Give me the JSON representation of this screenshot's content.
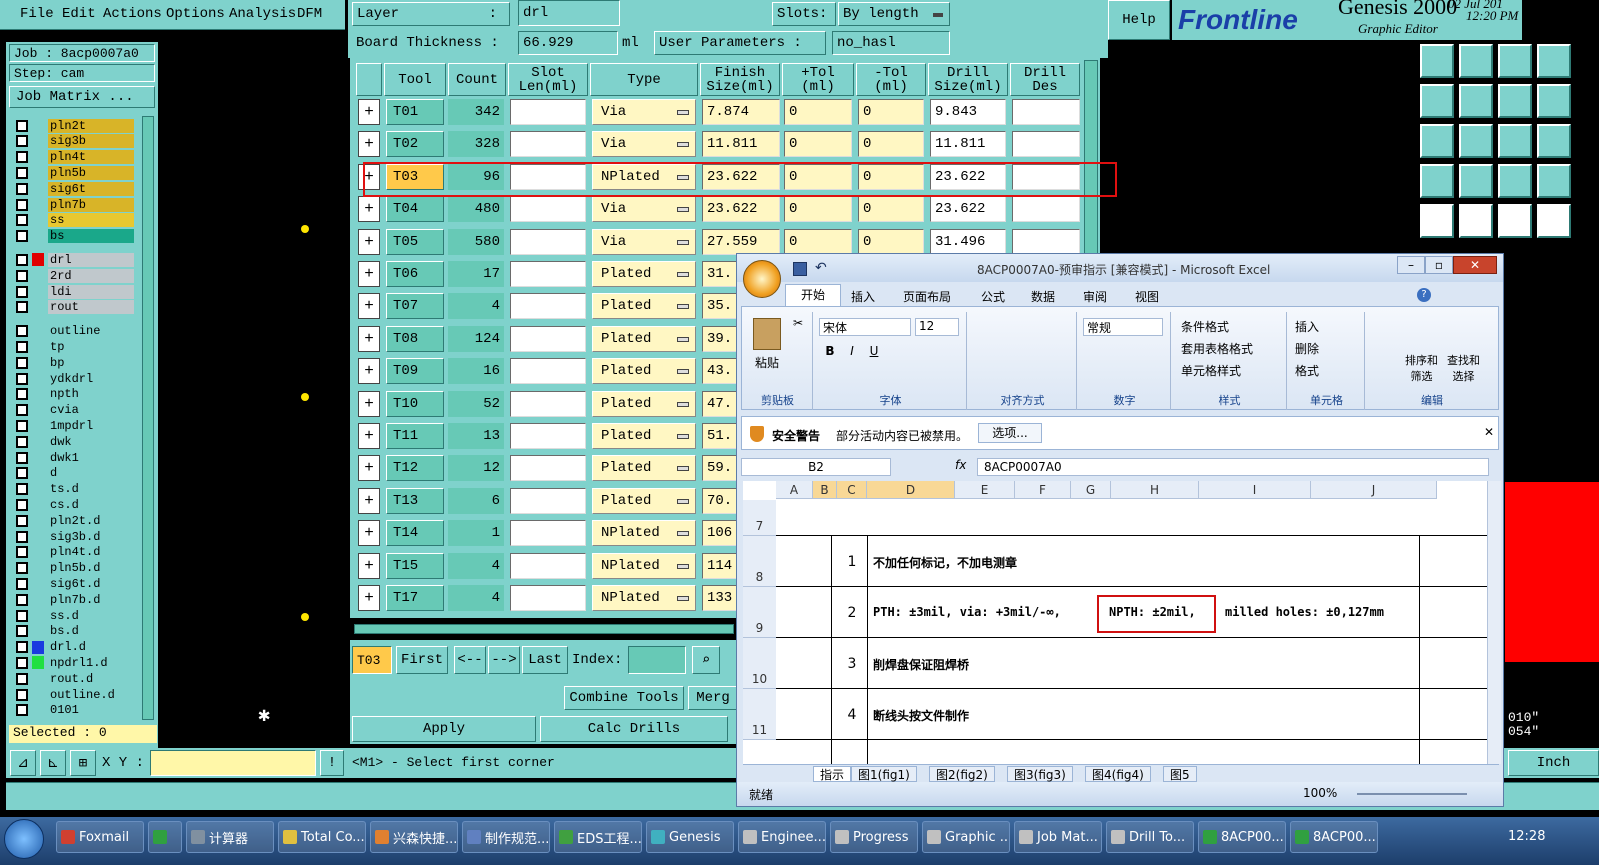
{
  "menu": [
    "File",
    "Edit",
    "Actions",
    "Options",
    "Analysis",
    "DFM"
  ],
  "toolbar": {
    "layer_label": "Layer",
    "layer_value": "drl",
    "slots_label": "Slots:",
    "slots_value": "By length",
    "board_thickness_label": "Board Thickness :",
    "board_thickness_value": "66.929",
    "board_thickness_unit": "ml",
    "user_params_label": "User Parameters :",
    "user_params_value": "no_hasl",
    "help": "Help"
  },
  "brand": {
    "name": "Frontline",
    "product": "Genesis 2000",
    "sub": "Graphic Editor",
    "date": "02 Jul 201",
    "time": "12:20 PM"
  },
  "job": {
    "job_line": "Job : 8acp0007a0",
    "step_line": "Step: cam",
    "matrix_btn": "Job Matrix ..."
  },
  "layers": [
    {
      "name": "pln2t",
      "color": "#d8b428"
    },
    {
      "name": "sig3b",
      "color": "#d8b428"
    },
    {
      "name": "pln4t",
      "color": "#d8b428"
    },
    {
      "name": "pln5b",
      "color": "#d8b428"
    },
    {
      "name": "sig6t",
      "color": "#d8b428"
    },
    {
      "name": "pln7b",
      "color": "#d8b428"
    },
    {
      "name": "ss",
      "color": "#e8c830"
    },
    {
      "name": "bs",
      "color": "#1aa88a"
    },
    {
      "name": "drl",
      "color": "#c0c8cc"
    },
    {
      "name": "2rd",
      "color": "#c0c8cc"
    },
    {
      "name": "ldi",
      "color": "#c0c8cc"
    },
    {
      "name": "rout",
      "color": "#c0c8cc"
    },
    {
      "name": "outline",
      "color": "#7fd2cc"
    },
    {
      "name": "tp",
      "color": "#7fd2cc"
    },
    {
      "name": "bp",
      "color": "#7fd2cc"
    },
    {
      "name": "ydkdrl",
      "color": "#7fd2cc"
    },
    {
      "name": "npth",
      "color": "#7fd2cc"
    },
    {
      "name": "cvia",
      "color": "#7fd2cc"
    },
    {
      "name": "1mpdrl",
      "color": "#7fd2cc"
    },
    {
      "name": "dwk",
      "color": "#7fd2cc"
    },
    {
      "name": "dwk1",
      "color": "#7fd2cc"
    },
    {
      "name": "d",
      "color": "#7fd2cc"
    },
    {
      "name": "ts.d",
      "color": "#7fd2cc"
    },
    {
      "name": "cs.d",
      "color": "#7fd2cc"
    },
    {
      "name": "pln2t.d",
      "color": "#7fd2cc"
    },
    {
      "name": "sig3b.d",
      "color": "#7fd2cc"
    },
    {
      "name": "pln4t.d",
      "color": "#7fd2cc"
    },
    {
      "name": "pln5b.d",
      "color": "#7fd2cc"
    },
    {
      "name": "sig6t.d",
      "color": "#7fd2cc"
    },
    {
      "name": "pln7b.d",
      "color": "#7fd2cc"
    },
    {
      "name": "ss.d",
      "color": "#7fd2cc"
    },
    {
      "name": "bs.d",
      "color": "#7fd2cc"
    },
    {
      "name": "drl.d",
      "color": "#7fd2cc"
    },
    {
      "name": "npdrl1.d",
      "color": "#7fd2cc"
    },
    {
      "name": "rout.d",
      "color": "#7fd2cc"
    },
    {
      "name": "outline.d",
      "color": "#7fd2cc"
    },
    {
      "name": "0101",
      "color": "#7fd2cc"
    }
  ],
  "selected_label": "Selected : 0",
  "columns": [
    "Tool",
    "Count",
    "Slot Len(ml)",
    "Type",
    "Finish Size(ml)",
    "+Tol (ml)",
    "-Tol (ml)",
    "Drill Size(ml)",
    "Drill Des"
  ],
  "rows": [
    {
      "tool": "T01",
      "count": "342",
      "type": "Via",
      "finish": "7.874",
      "ptol": "0",
      "mtol": "0",
      "drill": "9.843"
    },
    {
      "tool": "T02",
      "count": "328",
      "type": "Via",
      "finish": "11.811",
      "ptol": "0",
      "mtol": "0",
      "drill": "11.811"
    },
    {
      "tool": "T03",
      "count": "96",
      "type": "NPlated",
      "finish": "23.622",
      "ptol": "0",
      "mtol": "0",
      "drill": "23.622"
    },
    {
      "tool": "T04",
      "count": "480",
      "type": "Via",
      "finish": "23.622",
      "ptol": "0",
      "mtol": "0",
      "drill": "23.622"
    },
    {
      "tool": "T05",
      "count": "580",
      "type": "Via",
      "finish": "27.559",
      "ptol": "0",
      "mtol": "0",
      "drill": "31.496"
    },
    {
      "tool": "T06",
      "count": "17",
      "type": "Plated",
      "finish": "31.",
      "ptol": "",
      "mtol": "",
      "drill": ""
    },
    {
      "tool": "T07",
      "count": "4",
      "type": "Plated",
      "finish": "35.",
      "ptol": "",
      "mtol": "",
      "drill": ""
    },
    {
      "tool": "T08",
      "count": "124",
      "type": "Plated",
      "finish": "39.",
      "ptol": "",
      "mtol": "",
      "drill": ""
    },
    {
      "tool": "T09",
      "count": "16",
      "type": "Plated",
      "finish": "43.",
      "ptol": "",
      "mtol": "",
      "drill": ""
    },
    {
      "tool": "T10",
      "count": "52",
      "type": "Plated",
      "finish": "47.",
      "ptol": "",
      "mtol": "",
      "drill": ""
    },
    {
      "tool": "T11",
      "count": "13",
      "type": "Plated",
      "finish": "51.",
      "ptol": "",
      "mtol": "",
      "drill": ""
    },
    {
      "tool": "T12",
      "count": "12",
      "type": "Plated",
      "finish": "59.",
      "ptol": "",
      "mtol": "",
      "drill": ""
    },
    {
      "tool": "T13",
      "count": "6",
      "type": "Plated",
      "finish": "70.",
      "ptol": "",
      "mtol": "",
      "drill": ""
    },
    {
      "tool": "T14",
      "count": "1",
      "type": "NPlated",
      "finish": "106",
      "ptol": "",
      "mtol": "",
      "drill": ""
    },
    {
      "tool": "T15",
      "count": "4",
      "type": "NPlated",
      "finish": "114",
      "ptol": "",
      "mtol": "",
      "drill": ""
    },
    {
      "tool": "T17",
      "count": "4",
      "type": "NPlated",
      "finish": "133",
      "ptol": "",
      "mtol": "",
      "drill": ""
    }
  ],
  "nav": {
    "current": "T03",
    "first": "First",
    "prev": "<--",
    "next": "-->",
    "last": "Last",
    "index": "Index:",
    "combine": "Combine Tools",
    "merge": "Merg",
    "apply": "Apply",
    "calc": "Calc Drills"
  },
  "status": {
    "xy_label": "X Y :",
    "prompt": "<M1> - Select first corner",
    "readout1": "010\"",
    "readout2": "054\""
  },
  "excel": {
    "title": "8ACP0007A0-预审指示 [兼容模式] - Microsoft Excel",
    "tabs": [
      "开始",
      "插入",
      "页面布局",
      "公式",
      "数据",
      "审阅",
      "视图"
    ],
    "font": "宋体",
    "size": "12",
    "numfmt": "常规",
    "groups": [
      "剪贴板",
      "字体",
      "对齐方式",
      "数字",
      "样式",
      "单元格",
      "编辑"
    ],
    "ribbon": {
      "paste": "粘贴",
      "cond": "条件格式",
      "table": "套用表格格式",
      "cellstyle": "单元格样式",
      "insert": "插入",
      "delete": "删除",
      "format": "格式",
      "sort": "排序和\n筛选",
      "find": "查找和\n选择"
    },
    "security_title": "安全警告",
    "security_msg": "部分活动内容已被禁用。",
    "options_btn": "选项...",
    "cellref": "B2",
    "formula": "8ACP0007A0",
    "cols": [
      "A",
      "B",
      "C",
      "D",
      "E",
      "F",
      "G",
      "H",
      "I",
      "J"
    ],
    "rows": [
      {
        "n": "7",
        "num": "",
        "text": ""
      },
      {
        "n": "8",
        "num": "1",
        "text": "不加任何标记，不加电测章"
      },
      {
        "n": "9",
        "num": "2",
        "text": "PTH: ±3mil,  via: +3mil/-∞,",
        "text_box": "NPTH: ±2mil,",
        "text_tail": "milled holes: ±0,127mm"
      },
      {
        "n": "10",
        "num": "3",
        "text": "削焊盘保证阻焊桥"
      },
      {
        "n": "11",
        "num": "4",
        "text": "断线头按文件制作"
      }
    ],
    "sheets": [
      "指示",
      "图1(fig1)",
      "图2(fig2)",
      "图3(fig3)",
      "图4(fig4)",
      "图5"
    ],
    "status": "就绪",
    "zoom": "100%"
  },
  "taskbar": [
    {
      "label": "Foxmail",
      "color": "#d04030"
    },
    {
      "label": "",
      "color": "#30a040"
    },
    {
      "label": "计算器",
      "color": "#8090a0"
    },
    {
      "label": "Total Co...",
      "color": "#e0c040"
    },
    {
      "label": "兴森快捷...",
      "color": "#e08030"
    },
    {
      "label": "制作规范...",
      "color": "#6080c0"
    },
    {
      "label": "EDS工程...",
      "color": "#40a040"
    },
    {
      "label": "Genesis",
      "color": "#40b0c0"
    },
    {
      "label": "Enginee...",
      "color": "#c0c0c0"
    },
    {
      "label": "Progress",
      "color": "#c0c0c0"
    },
    {
      "label": "Graphic ...",
      "color": "#c0c0c0"
    },
    {
      "label": "Job Mat...",
      "color": "#c0c0c0"
    },
    {
      "label": "Drill To...",
      "color": "#c0c0c0"
    },
    {
      "label": "8ACP00...",
      "color": "#30a040"
    },
    {
      "label": "8ACP00...",
      "color": "#30a040"
    }
  ],
  "clock": "12:28"
}
